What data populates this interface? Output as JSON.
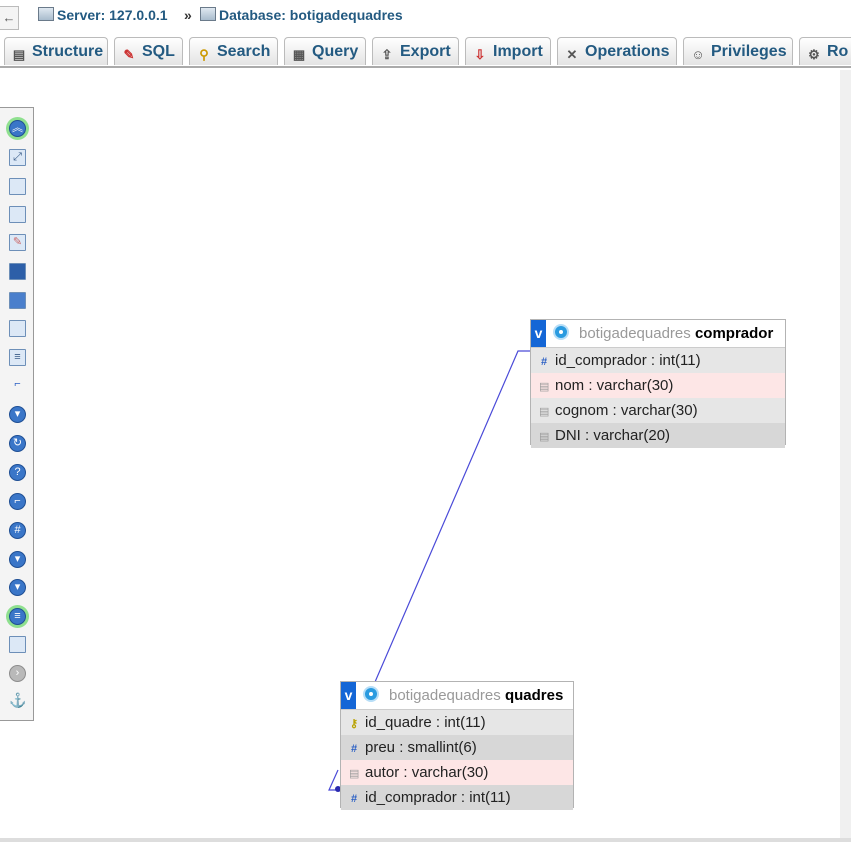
{
  "breadcrumb": {
    "back": "←",
    "server": "Server: 127.0.0.1",
    "separator": "»",
    "database": "Database: botigadequadres"
  },
  "tabs": [
    {
      "label": "Structure",
      "icon": "structure-icon"
    },
    {
      "label": "SQL",
      "icon": "sql-icon"
    },
    {
      "label": "Search",
      "icon": "search-icon"
    },
    {
      "label": "Query",
      "icon": "query-icon"
    },
    {
      "label": "Export",
      "icon": "export-icon"
    },
    {
      "label": "Import",
      "icon": "import-icon"
    },
    {
      "label": "Operations",
      "icon": "operations-icon"
    },
    {
      "label": "Privileges",
      "icon": "privileges-icon"
    },
    {
      "label": "Ro",
      "icon": "routines-icon"
    }
  ],
  "toolbar_icons": [
    "toggle-menu-icon",
    "fullscreen-icon",
    "add-tables-icon",
    "new-page-icon",
    "edit-page-icon",
    "save-icon",
    "save-as-icon",
    "delete-page-icon",
    "view-schema-icon",
    "create-relation-icon",
    "relation-lines-icon",
    "reload-icon",
    "help-icon",
    "angular-links-icon",
    "snap-to-grid-icon",
    "small-big-icon",
    "toggle-all-icon",
    "toggle-fields-icon",
    "export-schema-icon",
    "move-menu-icon",
    "pin-text-icon"
  ],
  "tables": {
    "comprador": {
      "db": "botigadequadres",
      "name": "comprador",
      "toggle": "v",
      "columns": [
        {
          "icon": "hash-icon",
          "text": "id_comprador : int(11)"
        },
        {
          "icon": "text-icon",
          "text": "nom : varchar(30)"
        },
        {
          "icon": "text-icon",
          "text": "cognom : varchar(30)"
        },
        {
          "icon": "text-icon",
          "text": "DNI : varchar(20)"
        }
      ]
    },
    "quadres": {
      "db": "botigadequadres",
      "name": "quadres",
      "toggle": "v",
      "columns": [
        {
          "icon": "key-icon",
          "text": "id_quadre : int(11)"
        },
        {
          "icon": "hash-icon",
          "text": "preu : smallint(6)"
        },
        {
          "icon": "text-icon",
          "text": "autor : varchar(30)"
        },
        {
          "icon": "hash-icon",
          "text": "id_comprador : int(11)"
        }
      ]
    }
  },
  "colors": {
    "link": "#235a81",
    "relation_line": "#4a4ad8",
    "toggle_button": "#1466d6"
  }
}
